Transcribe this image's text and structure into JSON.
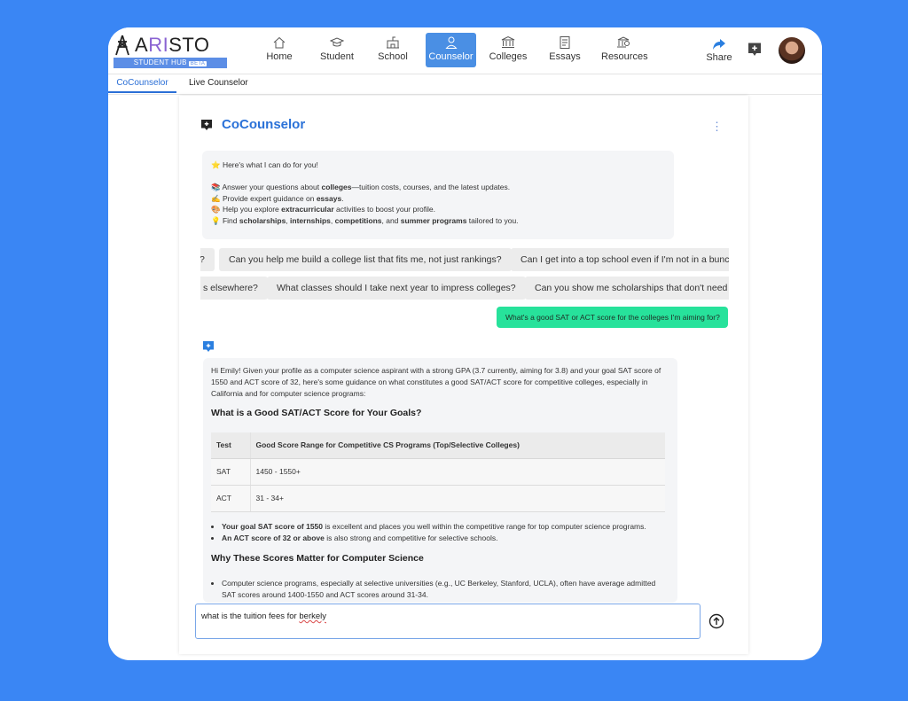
{
  "brand": {
    "name_a": "A",
    "name_ri": "RI",
    "name_sto": "STO",
    "subtitle": "STUDENT HUB",
    "badge": "BETA"
  },
  "nav": [
    {
      "label": "Home",
      "icon": "home-icon",
      "active": false
    },
    {
      "label": "Student",
      "icon": "graduation-cap-icon",
      "active": false
    },
    {
      "label": "School",
      "icon": "school-building-icon",
      "active": false
    },
    {
      "label": "Counselor",
      "icon": "person-icon",
      "active": true
    },
    {
      "label": "Colleges",
      "icon": "university-icon",
      "active": false
    },
    {
      "label": "Essays",
      "icon": "document-icon",
      "active": false
    },
    {
      "label": "Resources",
      "icon": "resources-icon",
      "active": false
    }
  ],
  "header": {
    "share_label": "Share"
  },
  "subtabs": [
    {
      "label": "CoCounselor",
      "active": true
    },
    {
      "label": "Live Counselor",
      "active": false
    }
  ],
  "panel": {
    "title": "CoCounselor",
    "intro": {
      "heading": "⭐ Here's what I can do for you!",
      "lines": [
        {
          "icon": "📚",
          "pre": "Answer your questions about ",
          "bold": "colleges",
          "post": "—tuition costs, courses, and the latest updates."
        },
        {
          "icon": "✍️",
          "pre": "Provide expert guidance on ",
          "bold": "essays",
          "post": "."
        },
        {
          "icon": "🎨",
          "pre": "Help you explore ",
          "bold": "extracurricular",
          "post": " activities to boost your profile."
        }
      ],
      "last_line": {
        "icon": "💡",
        "pre": "Find ",
        "b1": "scholarships",
        "s1": ", ",
        "b2": "internships",
        "s2": ", ",
        "b3": "competitions",
        "s3": ", and ",
        "b4": "summer programs",
        "post": " tailored to you."
      }
    },
    "suggestions_row1": [
      "?",
      "Can you help me build a college list that fits me, not just rankings?",
      "Can I get into a top school even if I'm not in a bunch"
    ],
    "suggestions_row2": [
      "s elsewhere?",
      "What classes should I take next year to impress colleges?",
      "Can you show me scholarships that don't need p"
    ],
    "user_message": "What's a good SAT or ACT score for the colleges I'm aiming for?",
    "reply": {
      "intro": "Hi Emily! Given your profile as a computer science aspirant with a strong GPA (3.7 currently, aiming for 3.8) and your goal SAT score of 1550 and ACT score of 32, here's some guidance on what constitutes a good SAT/ACT score for competitive colleges, especially in California and for computer science programs:",
      "heading1": "What is a Good SAT/ACT Score for Your Goals?",
      "table": {
        "headers": [
          "Test",
          "Good Score Range for Competitive CS Programs (Top/Selective Colleges)"
        ],
        "rows": [
          [
            "SAT",
            "1450 - 1550+"
          ],
          [
            "ACT",
            "31 - 34+"
          ]
        ]
      },
      "bullet1_bold": "Your goal SAT score of 1550",
      "bullet1_rest": " is excellent and places you well within the competitive range for top computer science programs.",
      "bullet2_bold": "An ACT score of 32 or above",
      "bullet2_rest": " is also strong and competitive for selective schools.",
      "heading2": "Why These Scores Matter for Computer Science",
      "bullet3": "Computer science programs, especially at selective universities (e.g., UC Berkeley, Stanford, UCLA), often have average admitted SAT scores around 1400-1550 and ACT scores around 31-34."
    },
    "input": {
      "value_pre": "what is the tuition fees for ",
      "value_err": "berkely"
    }
  },
  "colors": {
    "background": "#3a86f4",
    "accent": "#2b72d8",
    "nav_active": "#4a8fe4",
    "user_bubble": "#27e29b"
  }
}
